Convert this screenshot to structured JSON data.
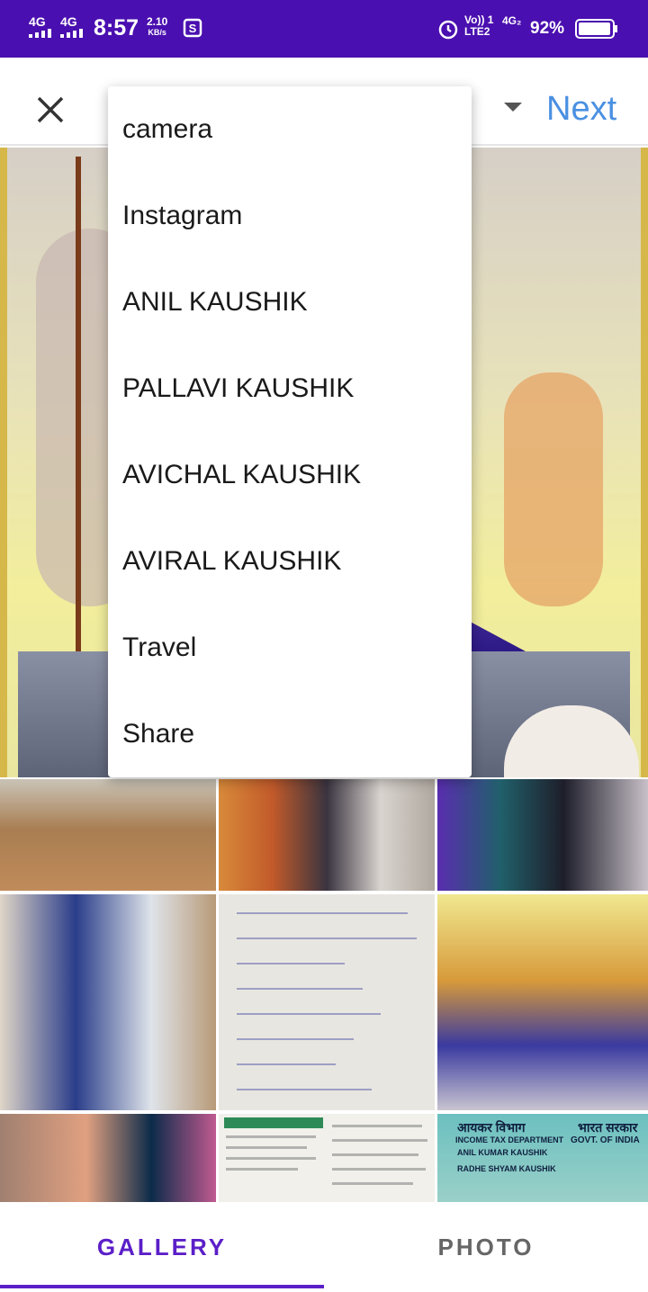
{
  "status_bar": {
    "network1": "4G",
    "network2": "4G",
    "time": "8:57",
    "speed_value": "2.10",
    "speed_unit": "KB/s",
    "volte": "Vo)) 1 LTE2",
    "network3": "4G₂",
    "battery_percent": "92%",
    "bg_color": "#4a0fb0"
  },
  "app_bar": {
    "close_icon": "close-icon",
    "dropdown_icon": "dropdown-arrow-icon",
    "next_label": "Next",
    "next_color": "#4a90e2"
  },
  "menu": {
    "items": [
      "camera",
      "Instagram",
      "ANIL KAUSHIK",
      "PALLAVI KAUSHIK",
      "AVICHAL KAUSHIK",
      "AVIRAL KAUSHIK",
      "Travel",
      "Share"
    ]
  },
  "grid": {
    "doc_text": [
      "आयकर विभाग",
      "INCOME TAX DEPARTMENT",
      "भारत सरकार",
      "GOVT. OF INDIA",
      "ANIL KUMAR KAUSHIK",
      "RADHE SHYAM KAUSHIK"
    ]
  },
  "tabs": {
    "gallery_label": "GALLERY",
    "photo_label": "PHOTO",
    "active": "GALLERY",
    "accent_color": "#5b1fc8"
  }
}
